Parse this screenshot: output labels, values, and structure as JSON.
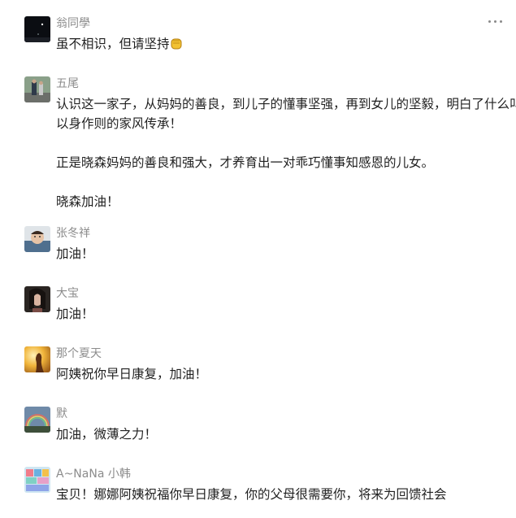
{
  "menu": {
    "icon": "more-horizontal-icon"
  },
  "comments": [
    {
      "name": "翁同學",
      "avatar": "avatar-dark-night",
      "lines": [
        "虽不相识，但请坚持"
      ],
      "emoji": "fist-emoji-icon"
    },
    {
      "name": "五尾",
      "avatar": "avatar-runners-photo",
      "lines": [
        "认识这一家子，从妈妈的善良，到儿子的懂事坚强，再到女儿的坚毅，明白了什么叫",
        "以身作则的家风传承！",
        "正是晓森妈妈的善良和强大，才养育出一对乖巧懂事知感恩的儿女。",
        "晓森加油！"
      ]
    },
    {
      "name": "张冬祥",
      "avatar": "avatar-baby-photo",
      "lines": [
        "加油！"
      ]
    },
    {
      "name": "大宝",
      "avatar": "avatar-woman-portrait",
      "lines": [
        "加油！"
      ]
    },
    {
      "name": "那个夏天",
      "avatar": "avatar-golden-silhouette",
      "lines": [
        "阿姨祝你早日康复，加油！"
      ]
    },
    {
      "name": "默",
      "avatar": "avatar-rainbow-landscape",
      "lines": [
        "加油，微薄之力！"
      ]
    },
    {
      "name": "A~NaNa 小韩",
      "avatar": "avatar-colorful-collage",
      "lines": [
        "宝贝！娜娜阿姨祝福你早日康复，你的父母很需要你，将来为回馈社会"
      ]
    }
  ]
}
